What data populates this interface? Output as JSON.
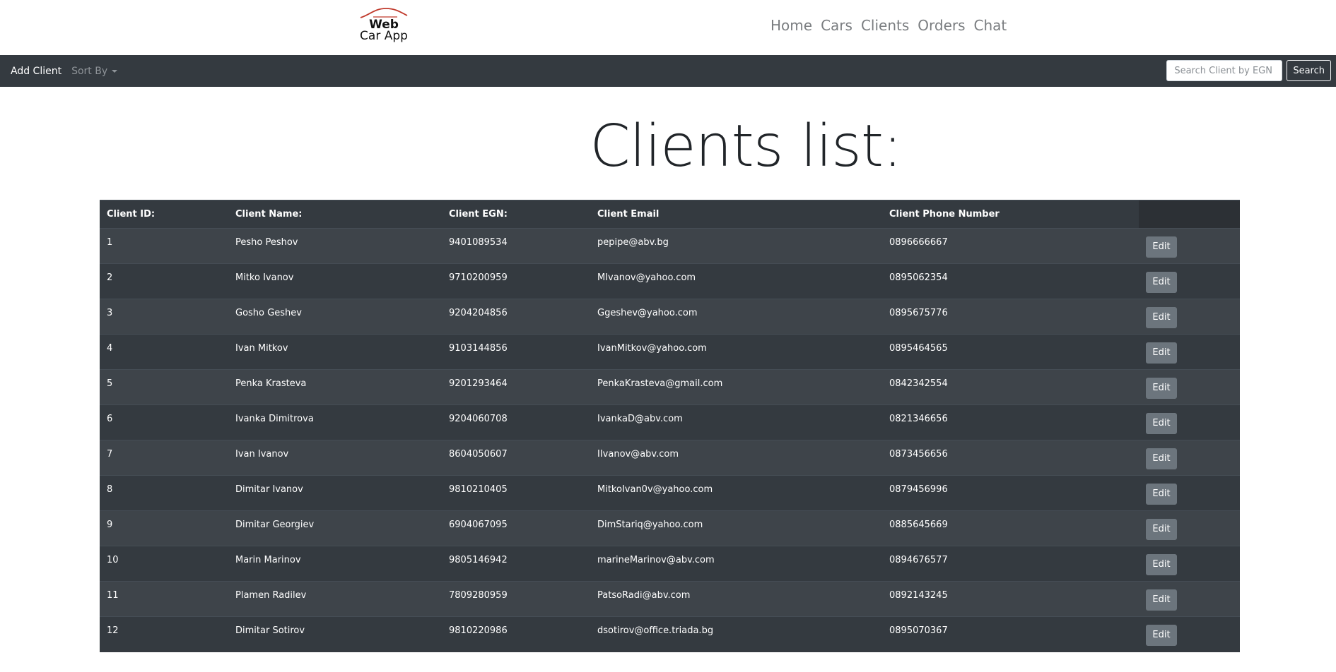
{
  "brand": {
    "line1": "Web",
    "line2": "Car App"
  },
  "nav": [
    "Home",
    "Cars",
    "Clients",
    "Orders",
    "Chat"
  ],
  "toolbar": {
    "add_label": "Add Client",
    "sort_label": "Sort By",
    "search_placeholder": "Search Client by EGN",
    "search_button": "Search"
  },
  "page_title": "Clients list:",
  "table": {
    "headers": [
      "Client ID:",
      "Client Name:",
      "Client EGN:",
      "Client Email",
      "Client Phone Number"
    ],
    "edit_label": "Edit",
    "rows": [
      [
        "1",
        "Pesho Peshov",
        "9401089534",
        "pepipe@abv.bg",
        "0896666667"
      ],
      [
        "2",
        "Mitko Ivanov",
        "9710200959",
        "MIvanov@yahoo.com",
        "0895062354"
      ],
      [
        "3",
        "Gosho Geshev",
        "9204204856",
        "Ggeshev@yahoo.com",
        "0895675776"
      ],
      [
        "4",
        "Ivan Mitkov",
        "9103144856",
        "IvanMitkov@yahoo.com",
        "0895464565"
      ],
      [
        "5",
        "Penka Krasteva",
        "9201293464",
        "PenkaKrasteva@gmail.com",
        "0842342554"
      ],
      [
        "6",
        "Ivanka Dimitrova",
        "9204060708",
        "IvankaD@abv.com",
        "0821346656"
      ],
      [
        "7",
        "Ivan Ivanov",
        "8604050607",
        "IIvanov@abv.com",
        "0873456656"
      ],
      [
        "8",
        "Dimitar Ivanov",
        "9810210405",
        "MitkoIvan0v@yahoo.com",
        "0879456996"
      ],
      [
        "9",
        "Dimitar Georgiev",
        "6904067095",
        "DimStariq@yahoo.com",
        "0885645669"
      ],
      [
        "10",
        "Marin Marinov",
        "9805146942",
        "marineMarinov@abv.com",
        "0894676577"
      ],
      [
        "11",
        "Plamen Radilev",
        "7809280959",
        "PatsoRadi@abv.com",
        "0892143245"
      ],
      [
        "12",
        "Dimitar Sotirov",
        "9810220986",
        "dsotirov@office.triada.bg",
        "0895070367"
      ]
    ]
  },
  "colors": {
    "bar": "#343a40",
    "row_alt": "#3e444a",
    "button": "#6c757d",
    "logo_arc": "#c0392b"
  }
}
